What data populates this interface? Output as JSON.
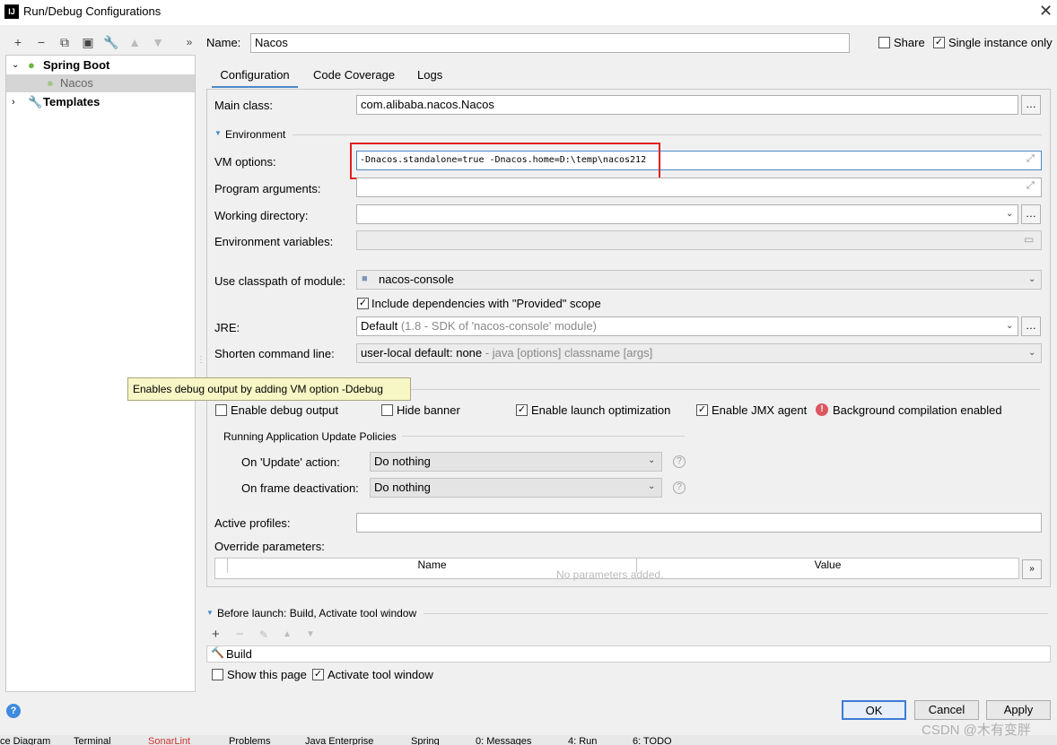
{
  "window": {
    "title": "Run/Debug Configurations",
    "app_icon": "IJ"
  },
  "toolbar": {
    "icons": [
      "add-icon",
      "remove-icon",
      "copy-icon",
      "save-icon",
      "wrench-icon",
      "move-up-icon",
      "move-down-icon",
      "more-icon"
    ]
  },
  "tree": {
    "spring_boot": "Spring Boot",
    "nacos": "Nacos",
    "templates": "Templates"
  },
  "header": {
    "name_label": "Name:",
    "name_value": "Nacos",
    "share_label": "Share",
    "single_instance_label": "Single instance only"
  },
  "tabs": [
    "Configuration",
    "Code Coverage",
    "Logs"
  ],
  "config": {
    "main_class_label": "Main class:",
    "main_class_value": "com.alibaba.nacos.Nacos",
    "environment_label": "Environment",
    "vm_options_label": "VM options:",
    "vm_options_value": "-Dnacos.standalone=true -Dnacos.home=D:\\temp\\nacos212",
    "program_args_label": "Program arguments:",
    "working_dir_label": "Working directory:",
    "env_vars_label": "Environment variables:",
    "classpath_label": "Use classpath of module:",
    "classpath_value": "nacos-console",
    "include_deps_label": "Include dependencies with \"Provided\" scope",
    "jre_label": "JRE:",
    "jre_value": "Default",
    "jre_hint": "(1.8 - SDK of 'nacos-console' module)",
    "shorten_label": "Shorten command line:",
    "shorten_value": "user-local default: none",
    "shorten_hint": "- java [options] classname [args]"
  },
  "tooltip": "Enables debug output by adding VM option -Ddebug",
  "spring_boot": {
    "enable_debug_label": "Enable debug output",
    "hide_banner_label": "Hide banner",
    "launch_opt_label": "Enable launch optimization",
    "jmx_label": "Enable JMX agent",
    "bg_compile_label": "Background compilation enabled",
    "policies_label": "Running Application Update Policies",
    "update_action_label": "On 'Update' action:",
    "update_action_value": "Do nothing",
    "frame_deact_label": "On frame deactivation:",
    "frame_deact_value": "Do nothing",
    "help_glyph": "?"
  },
  "profiles": {
    "active_label": "Active profiles:",
    "override_label": "Override parameters:",
    "col_name": "Name",
    "col_value": "Value",
    "empty_text": "No parameters added."
  },
  "before_launch": {
    "label": "Before launch: Build, Activate tool window",
    "build_item": "Build",
    "show_page_label": "Show this page",
    "activate_label": "Activate tool window"
  },
  "buttons": {
    "ok": "OK",
    "cancel": "Cancel",
    "apply": "Apply"
  },
  "status_bar": [
    "ce Diagram",
    "Terminal",
    "SonarLint",
    "Problems",
    "Java Enterprise",
    "Spring",
    "0: Messages",
    "4: Run",
    "6: TODO"
  ],
  "watermark": "CSDN @木有变胖",
  "colors": {
    "highlight_box": "#e02020",
    "tooltip_bg": "#f7f7c6",
    "tab_accent": "#4a88c7"
  }
}
